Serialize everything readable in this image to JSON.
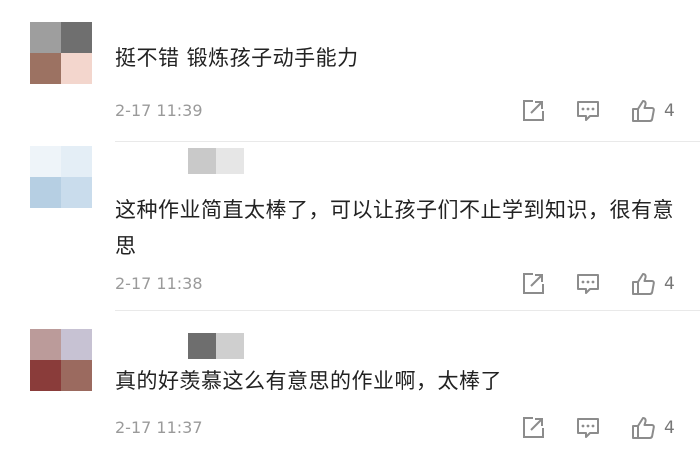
{
  "comments": [
    {
      "text": "挺不错  锻炼孩子动手能力",
      "time": "2-17 11:39",
      "likes": "4",
      "avatar_colors": [
        "#9e9e9e",
        "#6f6f6f",
        "#9c7262",
        "#f3d6cd"
      ],
      "username_colors": []
    },
    {
      "text": "这种作业简直太棒了，可以让孩子们不止学到知识，很有意思",
      "time": "2-17 11:38",
      "likes": "4",
      "avatar_colors": [
        "#eef4f9",
        "#e4eef6",
        "#b6cfe3",
        "#c9dcec"
      ],
      "username_colors": [
        "#c9c9c9",
        "#e6e6e6"
      ]
    },
    {
      "text": "真的好羡慕这么有意思的作业啊，太棒了",
      "time": "2-17 11:37",
      "likes": "4",
      "avatar_colors": [
        "#bb9b9a",
        "#c7c2d3",
        "#8a3c3a",
        "#9b6a5f"
      ],
      "username_colors": [
        "#6e6e6e",
        "#cfcfcf"
      ]
    }
  ],
  "icons": [
    "share-icon",
    "reply-icon",
    "thumbs-up-icon"
  ]
}
